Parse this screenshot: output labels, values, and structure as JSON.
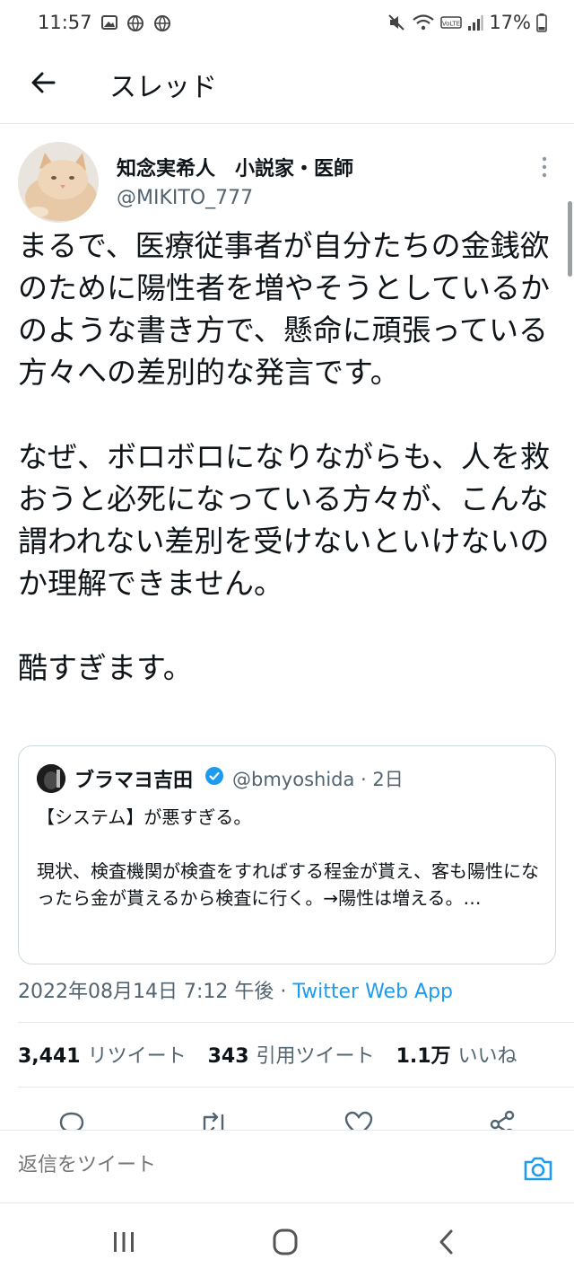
{
  "status_bar": {
    "time": "11:57",
    "battery": "17%"
  },
  "header": {
    "title": "スレッド",
    "back_icon": "arrow-left-icon"
  },
  "author": {
    "name": "知念実希人　小説家・医師",
    "handle": "@MIKITO_777"
  },
  "tweet": {
    "paragraphs": [
      "まるで、医療従事者が自分たちの金銭欲のために陽性者を増やそうとしているかのような書き方で、懸命に頑張っている方々への差別的な発言です。",
      "なぜ、ボロボロになりながらも、人を救おうと必死になっている方々が、こんな謂われない差別を受けないといけないのか理解できません。",
      "酷すぎます。"
    ]
  },
  "quote": {
    "name": "ブラマヨ吉田",
    "handle_time": "@bmyoshida · 2日",
    "line1": "【システム】が悪すぎる。",
    "line2": "現状、検査機関が検査をすればする程金が貰え、客も陽性になったら金が貰えるから検査に行く。→陽性は増える。…",
    "verified_color": "#1d9bf0"
  },
  "meta": {
    "timestamp": "2022年08月14日 7:12 午後 · ",
    "source": "Twitter Web App"
  },
  "stats": {
    "retweets_count": "3,441",
    "retweets_label": "リツイート",
    "quotes_count": "343",
    "quotes_label": "引用ツイート",
    "likes_count": "1.1万",
    "likes_label": "いいね"
  },
  "reply_bar": {
    "placeholder": "返信をツイート"
  },
  "colors": {
    "accent": "#1d9bf0",
    "text": "#0f1419",
    "muted": "#536471",
    "border": "#e6e9eb"
  }
}
